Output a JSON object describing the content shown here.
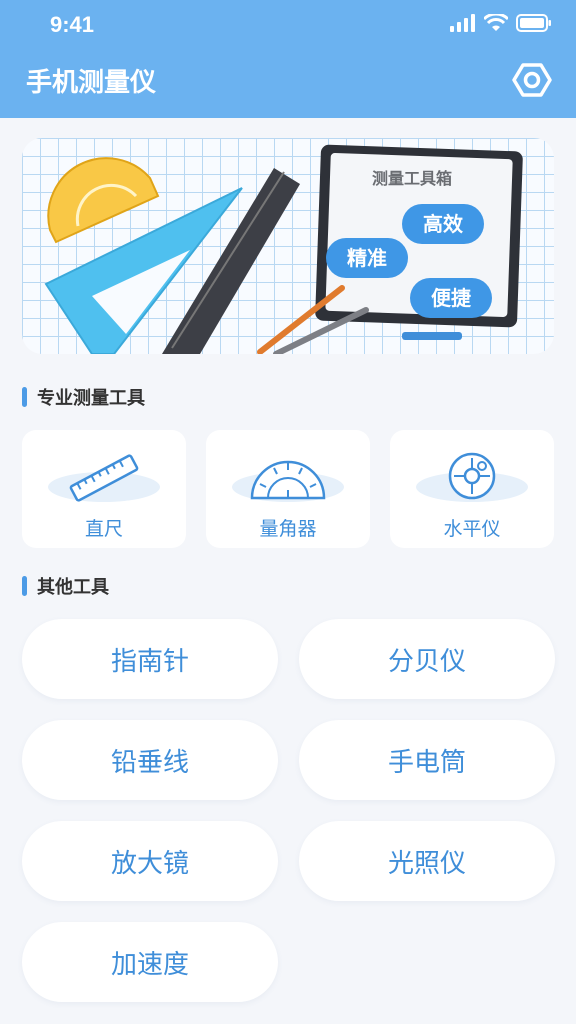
{
  "status_bar": {
    "time": "9:41"
  },
  "header": {
    "title": "手机测量仪",
    "settings_icon": "settings-hex-icon"
  },
  "banner": {
    "board_title": "测量工具箱",
    "tags": [
      "高效",
      "精准",
      "便捷"
    ]
  },
  "section_pro": {
    "title": "专业测量工具"
  },
  "pro_tools": [
    {
      "label": "直尺",
      "icon": "ruler-icon"
    },
    {
      "label": "量角器",
      "icon": "protractor-icon"
    },
    {
      "label": "水平仪",
      "icon": "level-icon"
    }
  ],
  "section_other": {
    "title": "其他工具"
  },
  "other_tools": [
    "指南针",
    "分贝仪",
    "铅垂线",
    "手电筒",
    "放大镜",
    "光照仪",
    "加速度"
  ],
  "colors": {
    "header": "#6bb2f0",
    "accent": "#3f8ed9",
    "background": "#f4f6fa"
  }
}
